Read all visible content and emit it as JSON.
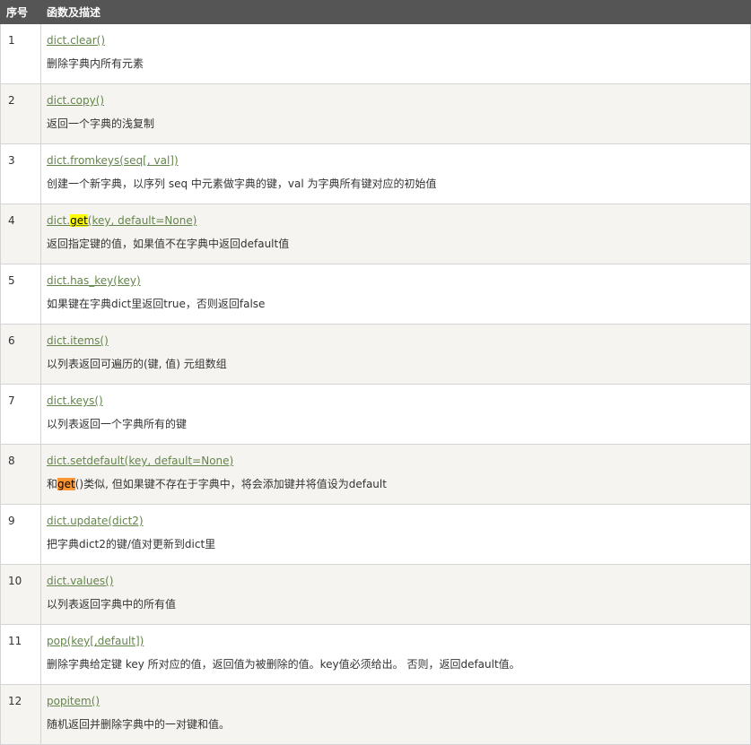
{
  "header": {
    "col_num": "序号",
    "col_desc": "函数及描述"
  },
  "colors": {
    "header_bg": "#555555",
    "header_text": "#ffffff",
    "link": "#64854c",
    "row_alt_bg": "#f6f4f0",
    "highlight_yellow": "#ffff00",
    "highlight_orange": "#ff9632"
  },
  "rows": [
    {
      "num": "1",
      "method": "dict.clear()",
      "desc": "删除字典内所有元素"
    },
    {
      "num": "2",
      "method": "dict.copy()",
      "desc": "返回一个字典的浅复制"
    },
    {
      "num": "3",
      "method": "dict.fromkeys(seq[, val])",
      "desc": "创建一个新字典，以序列 seq 中元素做字典的键，val 为字典所有键对应的初始值"
    },
    {
      "num": "4",
      "method_pre": "dict.",
      "method_hl": "get",
      "method_post": "(key, default=None)",
      "desc": "返回指定键的值，如果值不在字典中返回default值"
    },
    {
      "num": "5",
      "method": "dict.has_key(key)",
      "desc": "如果键在字典dict里返回true，否则返回false"
    },
    {
      "num": "6",
      "method": "dict.items()",
      "desc": "以列表返回可遍历的(键, 值) 元组数组"
    },
    {
      "num": "7",
      "method": "dict.keys()",
      "desc": "以列表返回一个字典所有的键"
    },
    {
      "num": "8",
      "method": "dict.setdefault(key, default=None)",
      "desc_pre": "和",
      "desc_hl": "get",
      "desc_post": "()类似, 但如果键不存在于字典中，将会添加键并将值设为default"
    },
    {
      "num": "9",
      "method": "dict.update(dict2)",
      "desc": "把字典dict2的键/值对更新到dict里"
    },
    {
      "num": "10",
      "method": "dict.values()",
      "desc": "以列表返回字典中的所有值"
    },
    {
      "num": "11",
      "method": "pop(key[,default])",
      "desc": "删除字典给定键 key 所对应的值，返回值为被删除的值。key值必须给出。 否则，返回default值。"
    },
    {
      "num": "12",
      "method": "popitem()",
      "desc": "随机返回并删除字典中的一对键和值。"
    }
  ]
}
